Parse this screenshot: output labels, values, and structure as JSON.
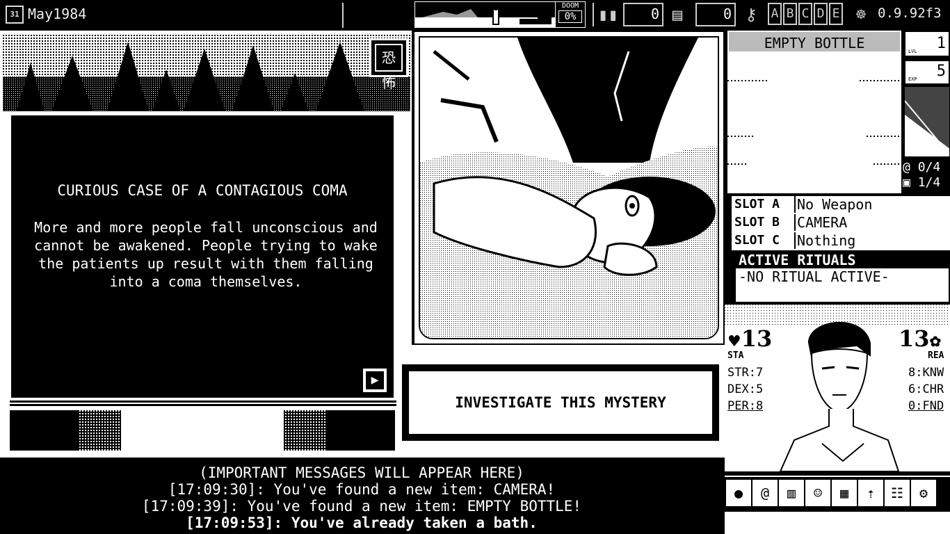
{
  "topbar": {
    "date": "May1984",
    "calendar_day": "31",
    "doom_label": "DOOM",
    "doom_value": "0%",
    "counter1": "0",
    "counter2": "0",
    "mystery_letters": [
      "A",
      "B",
      "C",
      "D",
      "E"
    ],
    "version": "0.9.92f3"
  },
  "case": {
    "icon_text": "恐怖",
    "title": "CURIOUS CASE OF A CONTAGIOUS COMA",
    "description": "More and more people fall unconscious and cannot be awakened. People trying to wake the patients up result with them falling into a coma themselves.",
    "next_icon": "play-icon"
  },
  "actions": {
    "investigate_label": "INVESTIGATE THIS MYSTERY"
  },
  "inventory": {
    "item_name": "EMPTY BOTTLE",
    "level_label": "LVL",
    "level_value": "1",
    "exp_label": "EXP",
    "exp_value": "5",
    "spiral_count": "0/4",
    "case_count": "1/4"
  },
  "slots": [
    {
      "key": "SLOT A",
      "value": "No Weapon"
    },
    {
      "key": "SLOT B",
      "value": "CAMERA"
    },
    {
      "key": "SLOT C",
      "value": "Nothing"
    }
  ],
  "rituals": {
    "header": "ACTIVE RITUALS",
    "body": "-NO RITUAL ACTIVE-"
  },
  "character": {
    "stamina": "13",
    "stamina_label": "STA",
    "reason": "13",
    "reason_label": "REA",
    "str": "STR:7",
    "dex": "DEX:5",
    "per": "PER:8",
    "knw": "8:KNW",
    "chr": "6:CHR",
    "fnd": "0:FND"
  },
  "toolbar_icons": [
    "old-god-icon",
    "spiral-icon",
    "stats-icon",
    "character-icon",
    "inventory-icon",
    "level-up-icon",
    "journal-icon",
    "settings-icon"
  ],
  "messages": [
    {
      "text": "(IMPORTANT MESSAGES WILL APPEAR HERE)"
    },
    {
      "text": "[17:09:30]: You've found a new item: CAMERA!"
    },
    {
      "text": "[17:09:39]: You've found a new item: EMPTY BOTTLE!"
    },
    {
      "text": "[17:09:53]: You've already taken a bath."
    }
  ]
}
